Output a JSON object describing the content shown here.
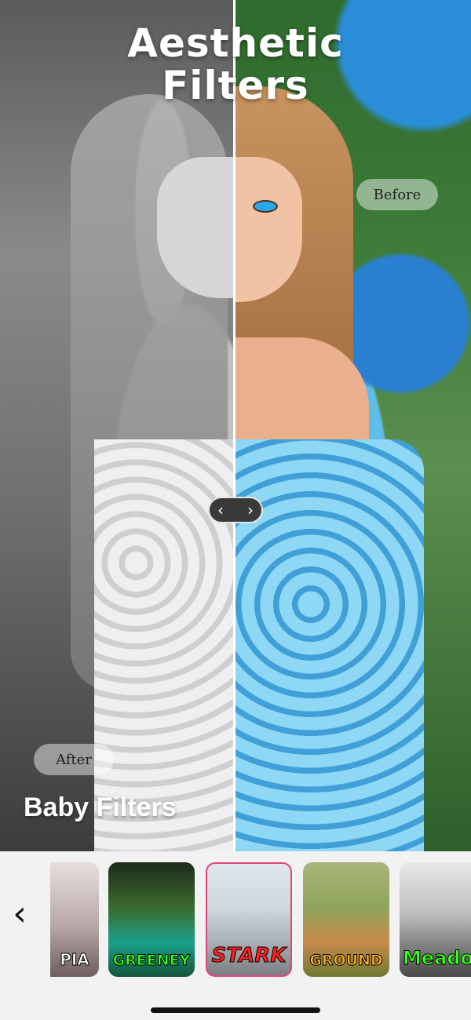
{
  "compare": {
    "title_line1": "Aesthetic",
    "title_line2": "Filters",
    "before_label": "Before",
    "after_label": "After",
    "filter_category": "Baby Filters",
    "handle_left": "‹",
    "handle_right": "›",
    "slider_position": 0.5
  },
  "filter_strip": {
    "back_icon": "chevron-left-icon",
    "items": [
      {
        "label": "PIA",
        "selected": false
      },
      {
        "label": "GREENEY",
        "selected": false
      },
      {
        "label": "STARK",
        "selected": true
      },
      {
        "label": "GROUND",
        "selected": false
      },
      {
        "label": "Meadow",
        "selected": false
      }
    ]
  },
  "colors": {
    "selected_border": "#e0457a",
    "background": "#f2f2f2"
  }
}
